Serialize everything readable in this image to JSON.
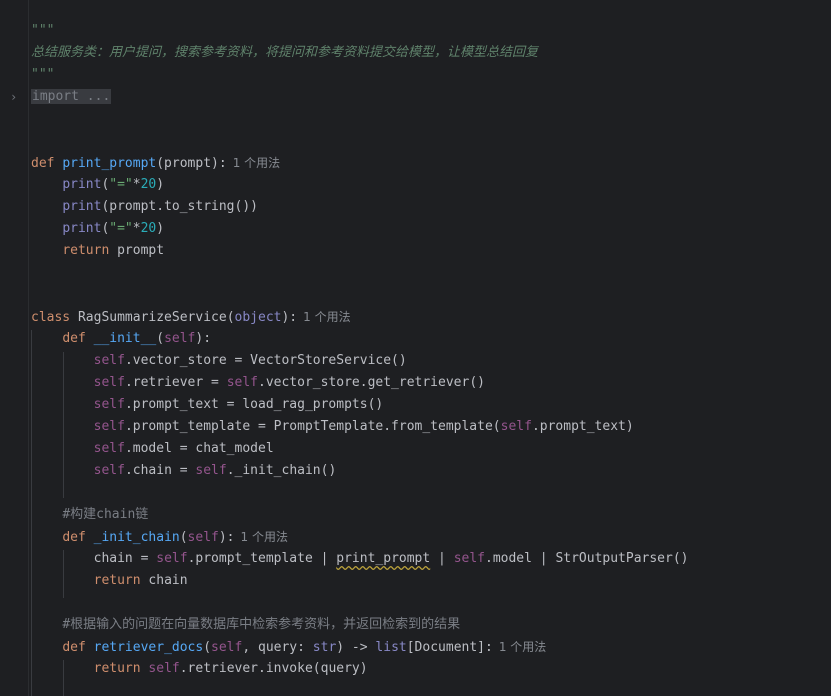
{
  "editor": {
    "docstring_open": "\"\"\"",
    "docstring_text": "总结服务类：用户提问，搜索参考资料，将提问和参考资料提交给模型，让模型总结回复",
    "docstring_close": "\"\"\"",
    "import_folded": "import ...",
    "hint_usages": "1 个用法",
    "comment_chain": "#构建chain链",
    "comment_retrieve": "#根据输入的问题在向量数据库中检索参考资料，并返回检索到的结果",
    "code": {
      "def_kw": "def",
      "class_kw": "class",
      "return_kw": "return",
      "print_prompt_name": "print_prompt",
      "print_prompt_params": "(prompt):",
      "print_call": "print",
      "eq_str": "\"=\"",
      "times": "*",
      "twenty": "20",
      "close_paren": ")",
      "open_paren": "(",
      "prompt_to_string": "(prompt.to_string())",
      "return_prompt": " prompt",
      "class_name": "RagSummarizeService",
      "object_builtin": "object",
      "class_tail": "):",
      "init_name": "__init__",
      "self_kw": "self",
      "init_tail": "):",
      "vector_store_assign": ".vector_store = VectorStoreService()",
      "retriever_assign_a": ".retriever = ",
      "retriever_assign_b": ".vector_store.get_retriever()",
      "prompt_text_assign": ".prompt_text = load_rag_prompts()",
      "prompt_template_assign_a": ".prompt_template = PromptTemplate.from_template(",
      "prompt_template_assign_b": ".prompt_text)",
      "model_assign": ".model = chat_model",
      "chain_assign_a": ".chain = ",
      "chain_assign_b": "._init_chain()",
      "init_chain_name": "_init_chain",
      "chain_expr_a": "chain = ",
      "chain_expr_b": ".prompt_template | ",
      "chain_expr_print_prompt": "print_prompt",
      "chain_expr_c": " | ",
      "chain_expr_d": ".model | StrOutputParser()",
      "return_chain": " chain",
      "retriever_docs_name": "retriever_docs",
      "retriever_docs_p1": ", query: ",
      "str_builtin": "str",
      "retriever_docs_p2": ") -> ",
      "list_builtin": "list",
      "retriever_docs_p3": "[Document]:",
      "return_invoke": ".retriever.invoke(query)"
    }
  }
}
